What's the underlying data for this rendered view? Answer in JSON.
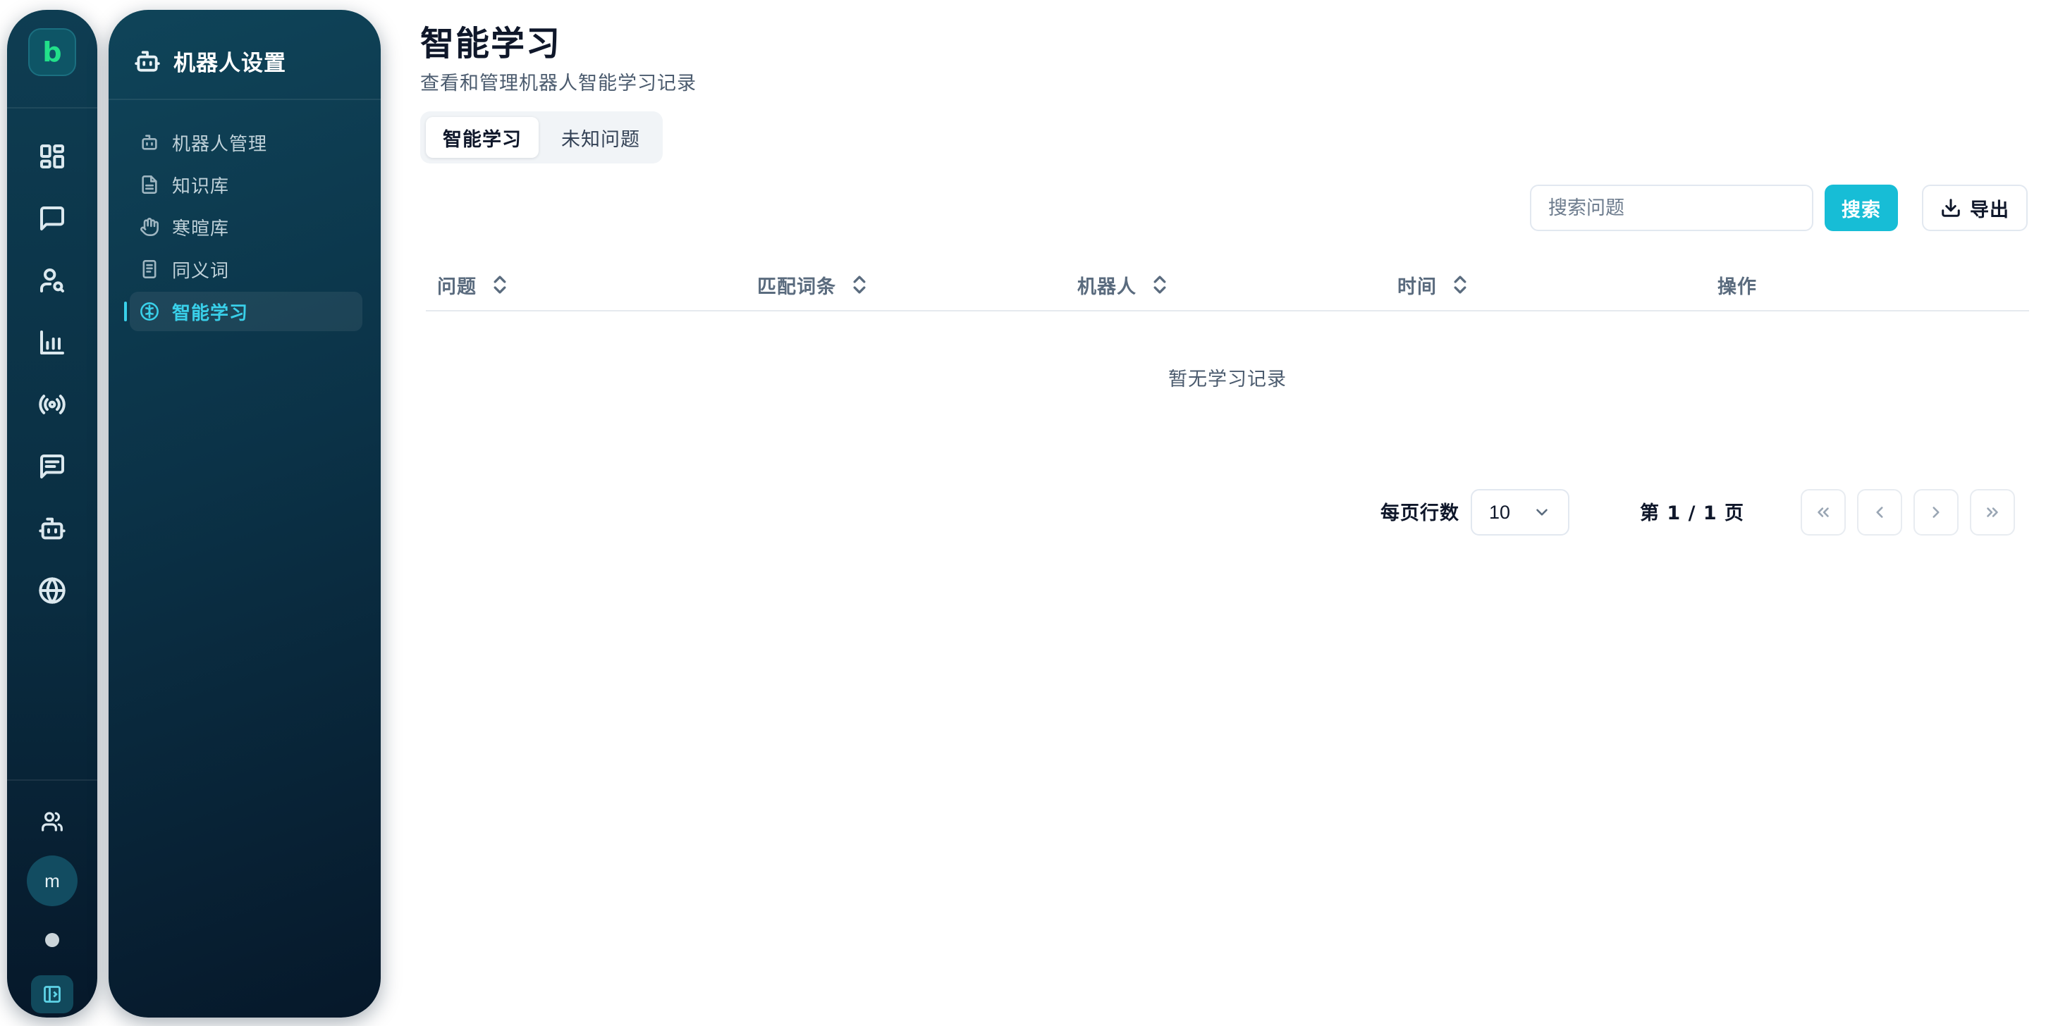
{
  "rail": {
    "logo_text": "b",
    "icons": [
      "dashboard-icon",
      "chat-icon",
      "user-search-icon",
      "bar-chart-icon",
      "broadcast-icon",
      "message-square-icon",
      "bot-icon",
      "globe-icon"
    ],
    "bottom_icons": [
      "users-icon",
      "sidebar-toggle-icon"
    ],
    "avatar_initial": "m"
  },
  "sidebar": {
    "title": "机器人设置",
    "title_icon": "bot-icon",
    "items": [
      {
        "label": "机器人管理",
        "icon": "bot-icon",
        "active": false
      },
      {
        "label": "知识库",
        "icon": "file-text-icon",
        "active": false
      },
      {
        "label": "寒暄库",
        "icon": "hand-icon",
        "active": false
      },
      {
        "label": "同义词",
        "icon": "book-icon",
        "active": false
      },
      {
        "label": "智能学习",
        "icon": "brain-icon",
        "active": true
      }
    ]
  },
  "header": {
    "title": "智能学习",
    "subtitle": "查看和管理机器人智能学习记录"
  },
  "tabs": [
    {
      "label": "智能学习",
      "active": true
    },
    {
      "label": "未知问题",
      "active": false
    }
  ],
  "toolbar": {
    "search_placeholder": "搜索问题",
    "search_value": "",
    "search_label": "搜索",
    "export_label": "导出",
    "export_icon": "download-icon"
  },
  "table": {
    "columns": [
      {
        "label": "问题",
        "sortable": true
      },
      {
        "label": "匹配词条",
        "sortable": true
      },
      {
        "label": "机器人",
        "sortable": true
      },
      {
        "label": "时间",
        "sortable": true
      },
      {
        "label": "操作",
        "sortable": false
      }
    ],
    "rows": [],
    "empty_text": "暂无学习记录"
  },
  "pagination": {
    "rows_per_page_label": "每页行数",
    "rows_per_page": "10",
    "page_info": "第 1 / 1 页",
    "current_page": 1,
    "total_pages": 1
  },
  "colors": {
    "accent": "#17bdd6",
    "sidebar_active": "#39d0ea",
    "sidebar_bg": "#0b3247",
    "logo_green": "#22e08a"
  }
}
